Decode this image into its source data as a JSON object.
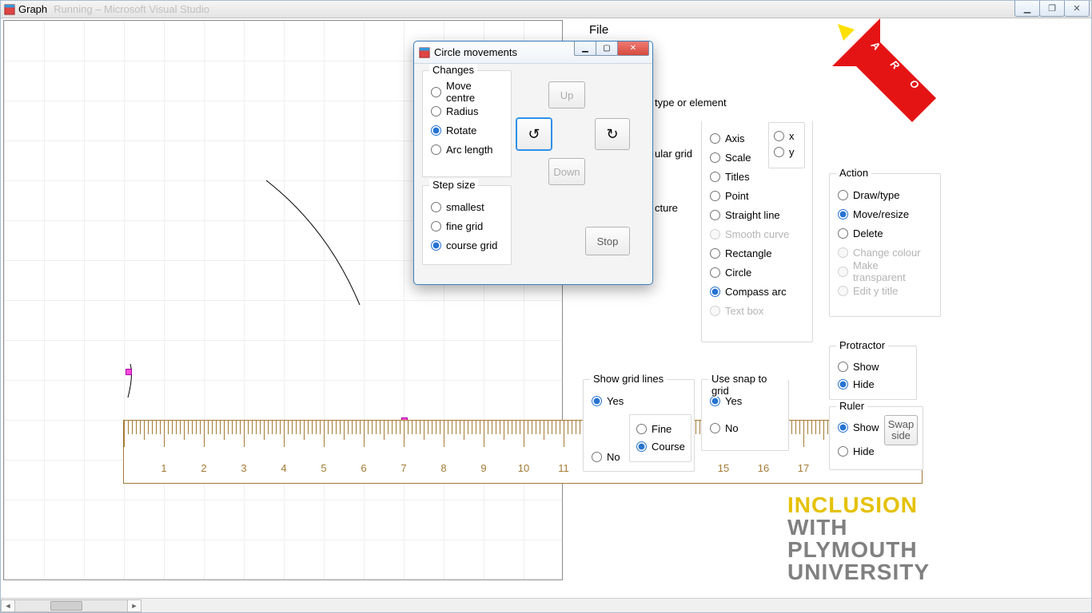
{
  "window": {
    "title": "Graph",
    "ghost_title": "Running  –  Microsoft Visual Studio"
  },
  "menu": {
    "file": "File"
  },
  "right_panel": {
    "hidden_header": "type or element",
    "hidden_item_1": "ular grid",
    "hidden_item_2": "cture",
    "element_type": {
      "axis": "Axis",
      "scale": "Scale",
      "titles": "Titles",
      "point": "Point",
      "line": "Straight line",
      "smooth": "Smooth curve",
      "rect": "Rectangle",
      "circle": "Circle",
      "arc": "Compass arc",
      "textbox": "Text box",
      "selected": "arc"
    },
    "xy": {
      "x": "x",
      "y": "y"
    },
    "action": {
      "label": "Action",
      "draw": "Draw/type",
      "move": "Move/resize",
      "delete": "Delete",
      "colour": "Change colour",
      "transparent": "Make transparent",
      "edit_title": "Edit y title",
      "selected": "move"
    },
    "gridlines": {
      "label": "Show grid lines",
      "yes": "Yes",
      "no": "No",
      "fine": "Fine",
      "course": "Course",
      "selected": "yes",
      "detail_selected": "course"
    },
    "snap": {
      "label": "Use snap to grid",
      "yes": "Yes",
      "no": "No",
      "selected": "yes"
    },
    "protractor": {
      "label": "Protractor",
      "show": "Show",
      "hide": "Hide",
      "selected": "hide"
    },
    "ruler": {
      "label": "Ruler",
      "show": "Show",
      "hide": "Hide",
      "selected": "show",
      "swap": "Swap side"
    }
  },
  "dialog": {
    "title": "Circle movements",
    "changes": {
      "label": "Changes",
      "move_centre": "Move centre",
      "radius": "Radius",
      "rotate": "Rotate",
      "arclen": "Arc length",
      "selected": "rotate"
    },
    "step": {
      "label": "Step size",
      "smallest": "smallest",
      "fine": "fine grid",
      "course": "course grid",
      "selected": "course"
    },
    "btn_up": "Up",
    "btn_down": "Down",
    "btn_stop": "Stop"
  },
  "ruler_numbers": [
    "1",
    "2",
    "3",
    "4",
    "5",
    "6",
    "7",
    "8",
    "9",
    "10",
    "11",
    "",
    "",
    "",
    "15",
    "16",
    "17"
  ],
  "logo_aro": {
    "letters": [
      "A",
      "R",
      "O"
    ]
  },
  "logo_inclusion": {
    "l1": "INCLUSION",
    "l2a": "WITH",
    "l2b": "PLYMOUTH",
    "l2c": "UNIVERSITY"
  }
}
